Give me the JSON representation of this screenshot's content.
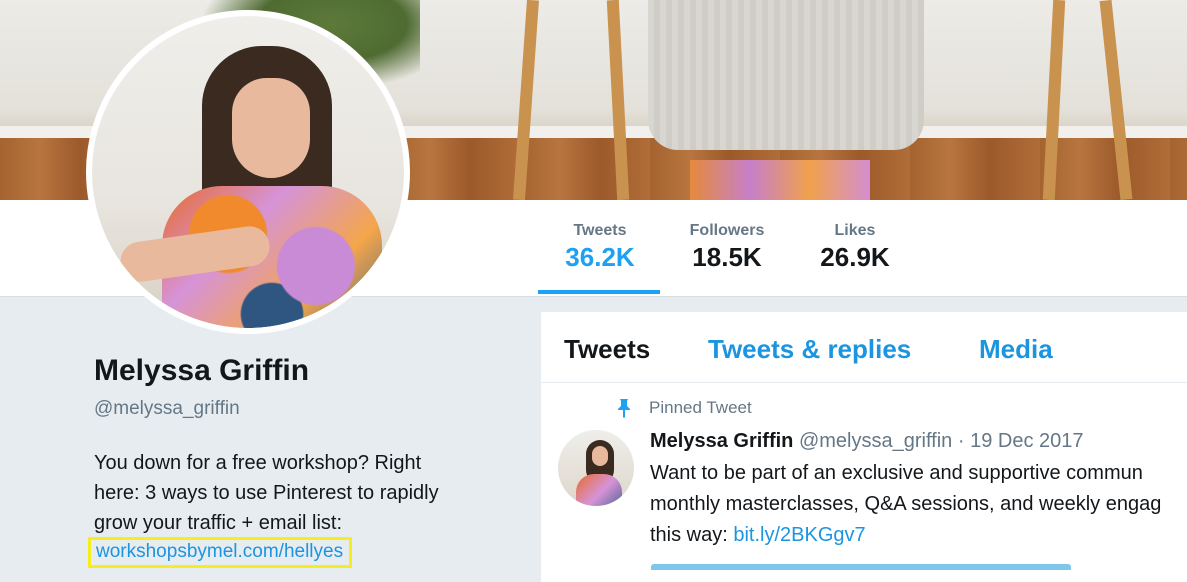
{
  "stats": [
    {
      "label": "Tweets",
      "value": "36.2K"
    },
    {
      "label": "Followers",
      "value": "18.5K"
    },
    {
      "label": "Likes",
      "value": "26.9K"
    }
  ],
  "profile": {
    "name": "Melyssa Griffin",
    "handle": "@melyssa_griffin",
    "bio_line1": "You down for a free workshop? Right",
    "bio_line2": "here: 3 ways to use Pinterest to rapidly",
    "bio_line3": "grow your traffic + email list:",
    "bio_link": "workshopsbymel.com/hellyes"
  },
  "timeline": {
    "tabs": [
      "Tweets",
      "Tweets & replies",
      "Media"
    ],
    "active_tab": "Tweets",
    "pinned_label": "Pinned Tweet",
    "tweet": {
      "name": "Melyssa Griffin",
      "handle": "@melyssa_griffin",
      "separator": "·",
      "date": "19 Dec 2017",
      "line1": "Want to be part of an exclusive and supportive commun",
      "line2": "monthly masterclasses, Q&A sessions, and weekly engag",
      "line3_prefix": "this way: ",
      "link": "bit.ly/2BKGgv7"
    }
  },
  "colors": {
    "accent": "#1da1f2",
    "link": "#1b95e0",
    "highlight_box": "#f6ee1c",
    "muted_text": "#657786"
  },
  "icons": {
    "pin": "pin-icon"
  }
}
